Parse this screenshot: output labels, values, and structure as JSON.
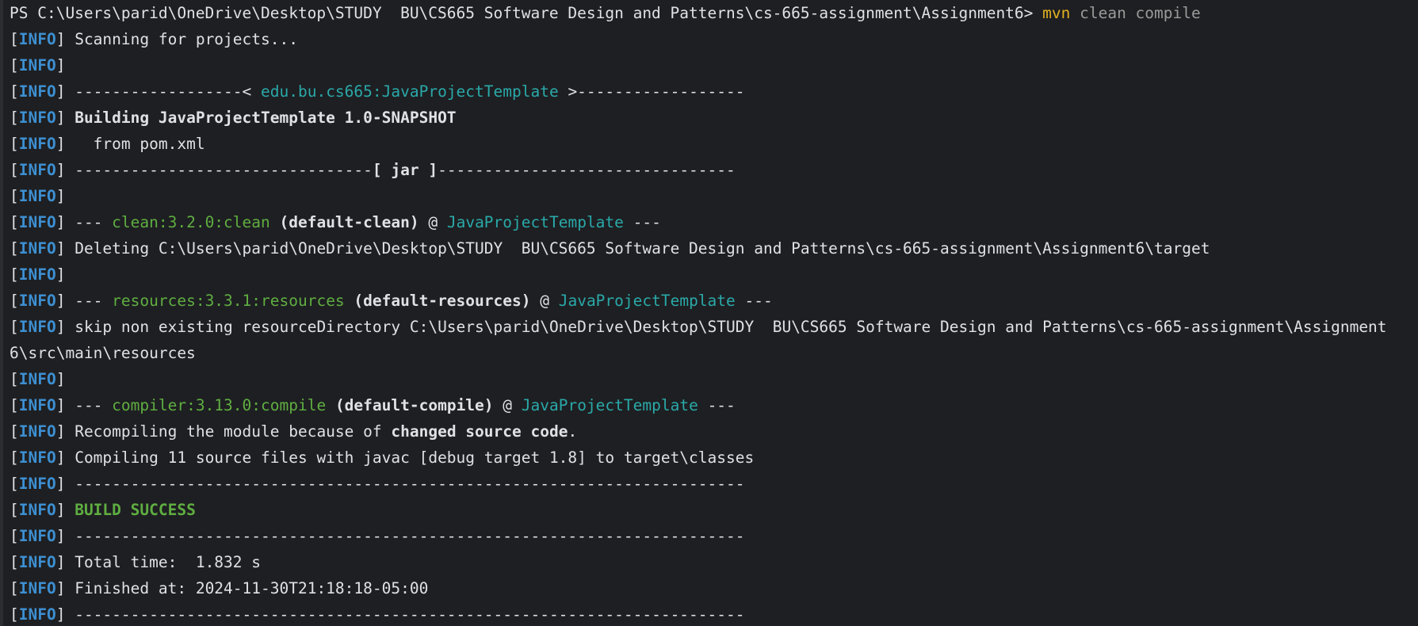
{
  "prompt": {
    "path": "PS C:\\Users\\parid\\OneDrive\\Desktop\\STUDY  BU\\CS665 Software Design and Patterns\\cs-665-assignment\\Assignment6> ",
    "command": "mvn",
    "args": " clean compile"
  },
  "tag": "INFO",
  "lines": {
    "l1": "Scanning for projects...",
    "l3_prefix": "------------------< ",
    "l3_coord": "edu.bu.cs665:JavaProjectTemplate",
    "l3_suffix": " >------------------",
    "l4": "Building JavaProjectTemplate 1.0-SNAPSHOT",
    "l5": "  from pom.xml",
    "l6_prefix": "--------------------------------",
    "l6_jar": "[ jar ]",
    "l6_suffix": "--------------------------------",
    "l8_dash": "--- ",
    "l8_plugin": "clean:3.2.0:clean",
    "l8_exec": " (default-clean)",
    "l8_at": " @ ",
    "l8_project": "JavaProjectTemplate",
    "l8_end": " ---",
    "l9": "Deleting C:\\Users\\parid\\OneDrive\\Desktop\\STUDY  BU\\CS665 Software Design and Patterns\\cs-665-assignment\\Assignment6\\target",
    "l11_dash": "--- ",
    "l11_plugin": "resources:3.3.1:resources",
    "l11_exec": " (default-resources)",
    "l11_at": " @ ",
    "l11_project": "JavaProjectTemplate",
    "l11_end": " ---",
    "l12": "skip non existing resourceDirectory C:\\Users\\parid\\OneDrive\\Desktop\\STUDY  BU\\CS665 Software Design and Patterns\\cs-665-assignment\\Assignment",
    "l12_wrap": "6\\src\\main\\resources",
    "l14_dash": "--- ",
    "l14_plugin": "compiler:3.13.0:compile",
    "l14_exec": " (default-compile)",
    "l14_at": " @ ",
    "l14_project": "JavaProjectTemplate",
    "l14_end": " ---",
    "l15_prefix": "Recompiling the module because of ",
    "l15_bold": "changed source code",
    "l15_suffix": ".",
    "l16": "Compiling 11 source files with javac [debug target 1.8] to target\\classes",
    "separator": "------------------------------------------------------------------------",
    "l18": "BUILD SUCCESS",
    "l20": "Total time:  1.832 s",
    "l21": "Finished at: 2024-11-30T21:18:18-05:00"
  }
}
